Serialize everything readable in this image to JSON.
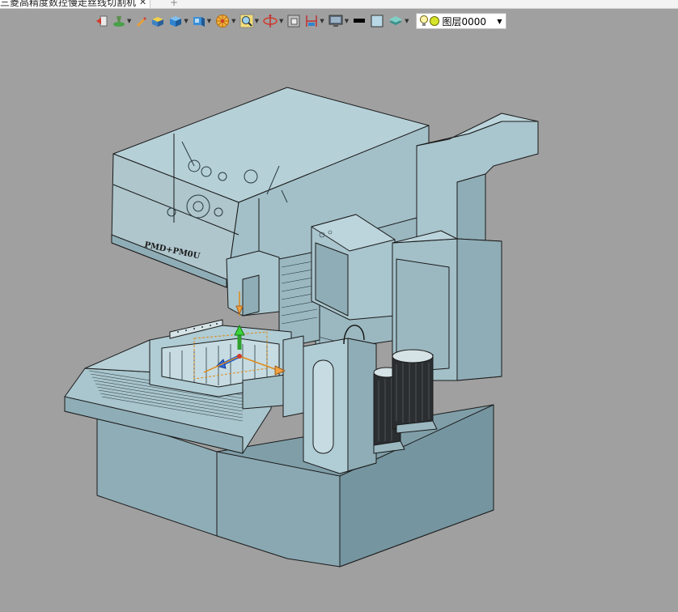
{
  "tab": {
    "title": "三菱高精度数控慢走丝线切割机",
    "close_icon": "close-icon",
    "add_icon": "plus-icon"
  },
  "toolbar": {
    "layer_value": "图层0000",
    "tools": [
      "exit-icon",
      "sketch-icon",
      "pencil-icon",
      "box-icon",
      "cube-icon",
      "shade-icon",
      "wheel-icon",
      "zoom-fit-icon",
      "rotate-axis-icon",
      "section-icon",
      "dimension-icon",
      "monitor-icon",
      "color-black-icon",
      "color-square-icon",
      "layers-icon"
    ]
  },
  "colors": {
    "viewport_bg": "#a0a0a0",
    "model_fill": "#9fbcc5",
    "model_dark": "#7f9ea8",
    "model_light": "#b6d0d8",
    "edge": "#1a1a1a"
  }
}
